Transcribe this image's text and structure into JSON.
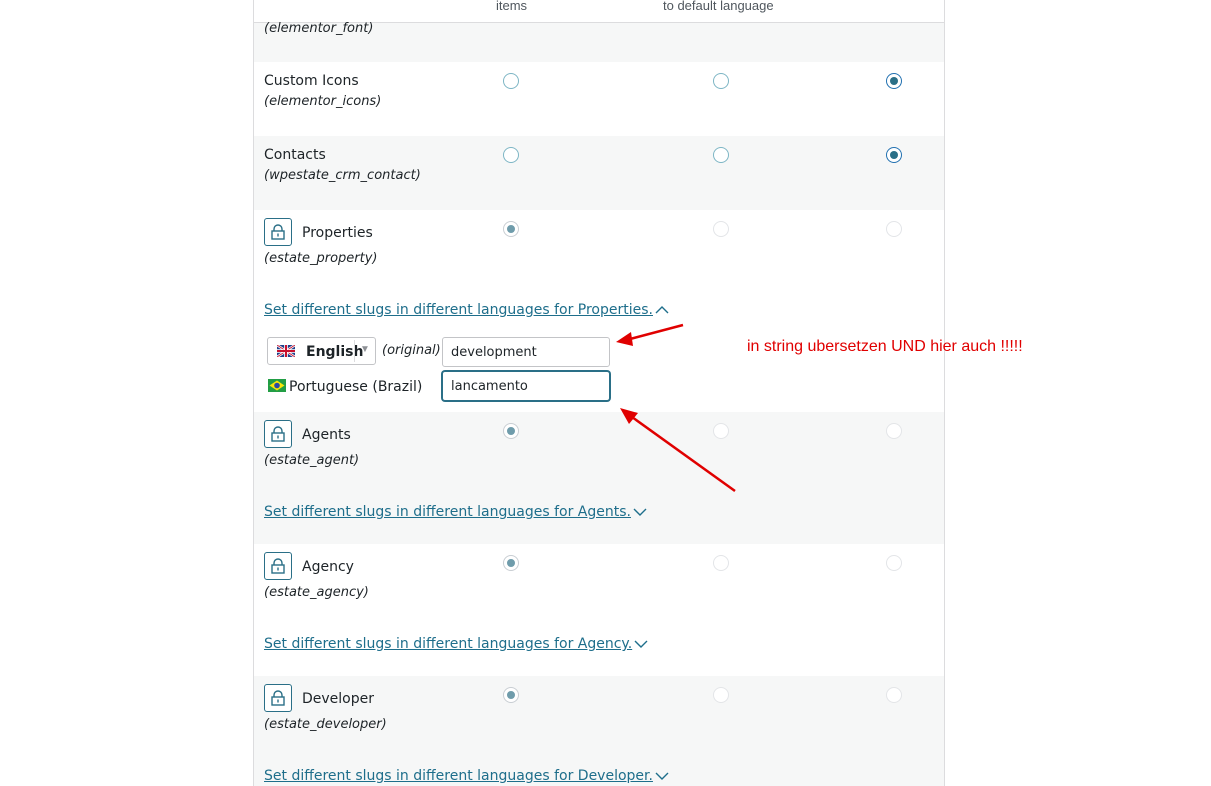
{
  "header": {
    "col_items": "items",
    "col_default": "to default language"
  },
  "rows": [
    {
      "slug": "(elementor_font)"
    },
    {
      "name": "Custom Icons",
      "slug": "(elementor_icons)"
    },
    {
      "name": "Contacts",
      "slug": "(wpestate_crm_contact)"
    },
    {
      "name": "Properties",
      "slug": "(estate_property)",
      "link": "Set different slugs in different languages for Properties."
    },
    {
      "name": "Agents",
      "slug": "(estate_agent)",
      "link": "Set different slugs in different languages for Agents."
    },
    {
      "name": "Agency",
      "slug": "(estate_agency)",
      "link": "Set different slugs in different languages for Agency."
    },
    {
      "name": "Developer",
      "slug": "(estate_developer)",
      "link": "Set different slugs in different languages for Developer."
    }
  ],
  "slug_editor": {
    "original_lang": "English",
    "original_tag": "(original)",
    "original_value": "development",
    "translation_lang": "Portuguese (Brazil)",
    "translation_value": "lancamento"
  },
  "annotation": {
    "text": "in string ubersetzen UND hier auch !!!!!",
    "color": "#e00000"
  },
  "colors": {
    "accent": "#2a6f87",
    "link": "#1e6e8b",
    "row_alt": "#f6f7f7"
  }
}
